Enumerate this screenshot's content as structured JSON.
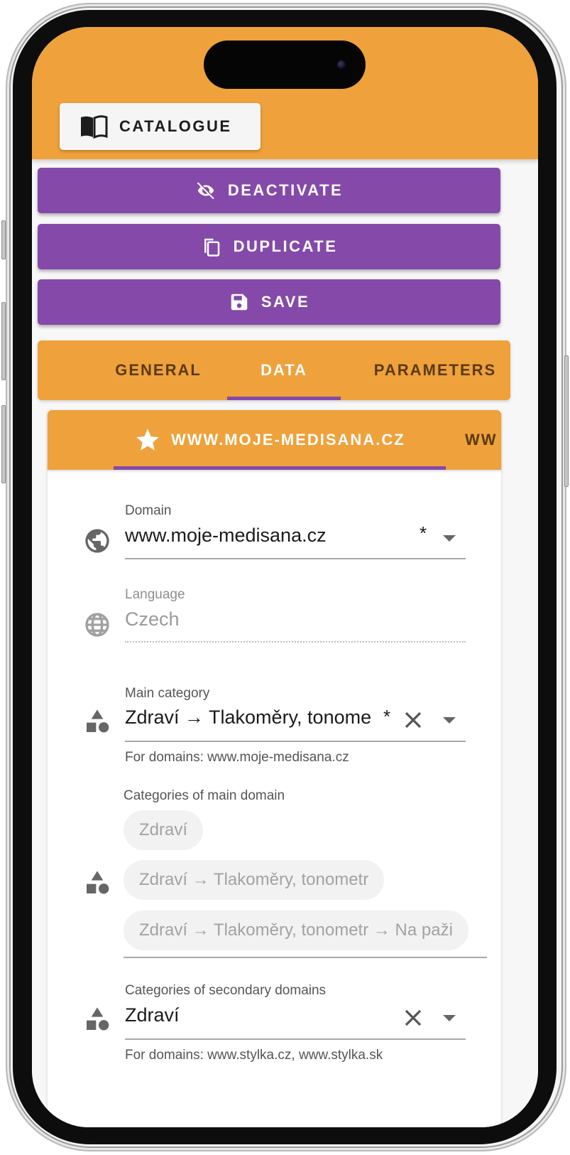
{
  "appbar": {
    "catalogue_label": "CATALOGUE",
    "icon": "book-open-icon",
    "background_color": "#efa13b"
  },
  "actions": [
    {
      "label": "DEACTIVATE",
      "icon": "eye-off-icon"
    },
    {
      "label": "DUPLICATE",
      "icon": "copy-icon"
    },
    {
      "label": "SAVE",
      "icon": "floppy-disk-icon"
    }
  ],
  "action_color": "#8549aa",
  "tabs": [
    {
      "label": "GENERAL",
      "active": false
    },
    {
      "label": "DATA",
      "active": true
    },
    {
      "label": "PARAMETERS",
      "active": false
    }
  ],
  "domain_tabs": [
    {
      "label": "WWW.MOJE-MEDISANA.CZ",
      "icon": "star-icon",
      "active": true
    },
    {
      "label": "WW",
      "active": false
    }
  ],
  "form": {
    "domain": {
      "label": "Domain",
      "value": "www.moje-medisana.cz",
      "required_mark": "*",
      "icon": "globe-filled-icon"
    },
    "language": {
      "label": "Language",
      "value": "Czech",
      "icon": "globe-outline-icon",
      "disabled": true
    },
    "main_category": {
      "label": "Main category",
      "value": "Zdraví → Tlakoměry, tonome",
      "required_mark": "*",
      "hint": "For domains: www.moje-medisana.cz",
      "icon": "category-shapes-icon"
    },
    "main_domain_categories": {
      "label": "Categories of main domain",
      "chips": [
        "Zdraví",
        "Zdraví → Tlakoměry, tonometr",
        "Zdraví → Tlakoměry, tonometr → Na paži"
      ],
      "icon": "category-shapes-icon"
    },
    "secondary_domain_categories": {
      "label": "Categories of secondary domains",
      "value": "Zdraví",
      "hint": "For domains: www.stylka.cz, www.stylka.sk",
      "icon": "category-shapes-icon"
    }
  }
}
